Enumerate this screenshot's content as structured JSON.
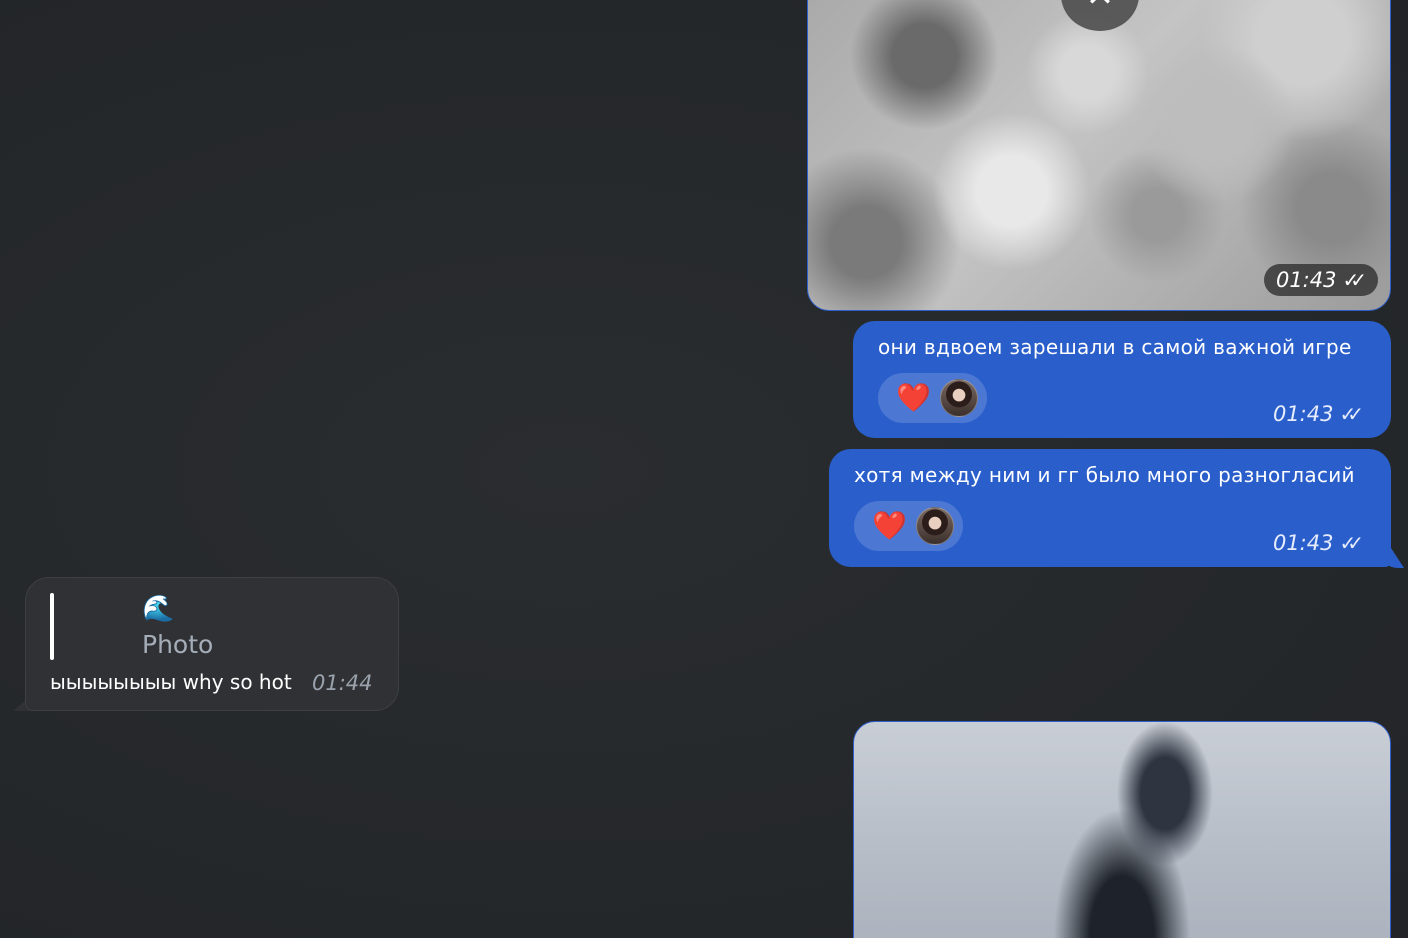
{
  "messages": {
    "photo_top": {
      "time": "01:43",
      "close_icon": "close-icon",
      "status_icon": "double-check-icon"
    },
    "out1": {
      "text": "они вдвоем зарешали в самой важной игре",
      "reaction": "❤️",
      "time": "01:43",
      "status": "✓✓"
    },
    "out2": {
      "text": "хотя между ним и гг было много разногласий",
      "reaction": "❤️",
      "time": "01:43",
      "status": "✓✓"
    },
    "in1": {
      "reply_emoji": "🌊",
      "reply_label": "Photo",
      "text": "ыыыыыыыы why so hot",
      "time": "01:44"
    }
  },
  "colors": {
    "background": "#25282b",
    "outgoing_bubble": "#2a5fcb",
    "incoming_bubble": "#2f3134",
    "heart": "#e8202a"
  }
}
